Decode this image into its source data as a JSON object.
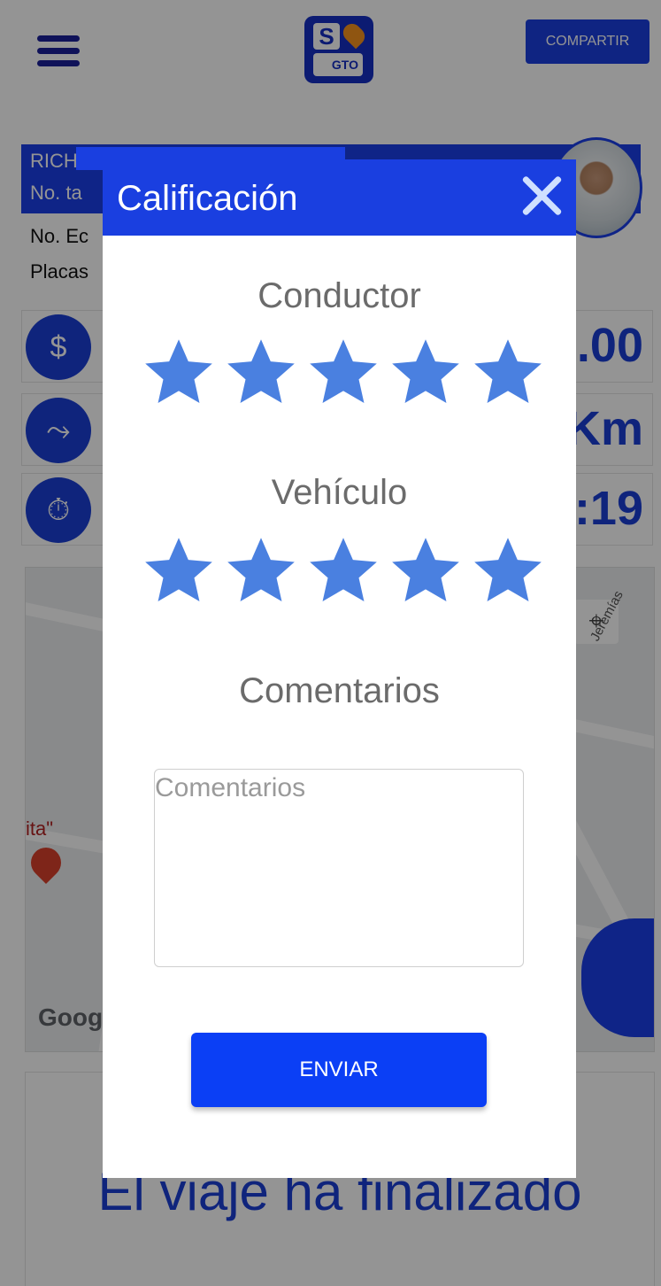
{
  "header": {
    "share_label": "COMPARTIR",
    "logo_letters": "S",
    "logo_sub": "GTO"
  },
  "driver": {
    "name_partial": "RICH",
    "taxi_label_partial": "No. ta",
    "eco_label_partial": "No. Ec",
    "plates_label_partial": "Placas"
  },
  "stats": [
    {
      "icon": "taxi-fare-icon",
      "value_partial": ".00"
    },
    {
      "icon": "route-icon",
      "value_partial": "Km"
    },
    {
      "icon": "taximeter-icon",
      "value_partial": ":19"
    }
  ],
  "map": {
    "street_label": "Jeremías",
    "poi_label_partial": "ita\"",
    "attribution_partial": "Goog"
  },
  "trip": {
    "status_text": "El viaje ha finalizado"
  },
  "modal": {
    "title": "Calificación",
    "driver_label": "Conductor",
    "vehicle_label": "Vehículo",
    "comments_label": "Comentarios",
    "comments_placeholder": "Comentarios",
    "comments_value": "",
    "submit_label": "ENVIAR",
    "driver_rating": 5,
    "vehicle_rating": 5,
    "max_rating": 5,
    "star_color": "#4a80e0"
  }
}
